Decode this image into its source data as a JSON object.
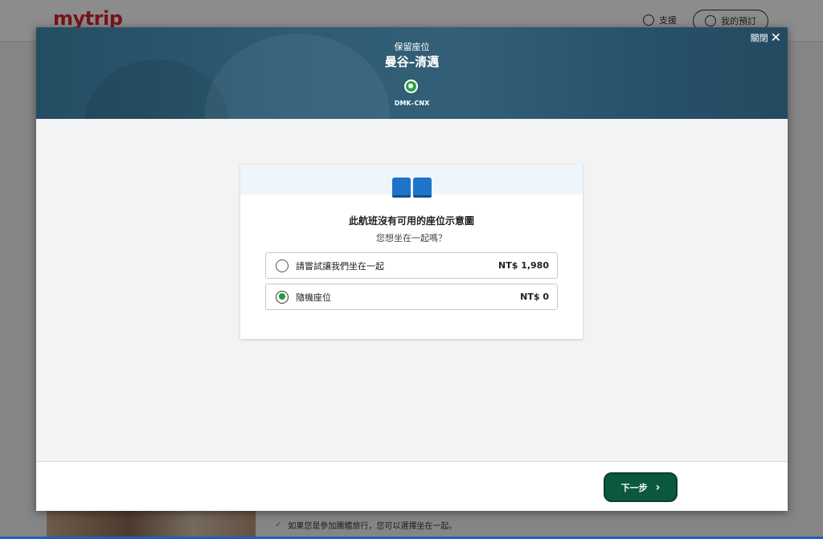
{
  "background": {
    "logo": "mytrip",
    "support_label": "支援",
    "booking_label": "我的預訂",
    "note": "如果您是參加團體旅行，您可以選擇坐在一起。"
  },
  "modal": {
    "close_label": "關閉",
    "kicker": "保留座位",
    "title": "曼谷–清邁",
    "step_label": "DMK–CNX",
    "card": {
      "title": "此航班沒有可用的座位示意圖",
      "subtitle": "您想坐在一起嗎？",
      "options": [
        {
          "label": "請嘗試讓我們坐在一起",
          "price": "NT$ 1,980",
          "selected": false
        },
        {
          "label": "隨機座位",
          "price": "NT$ 0",
          "selected": true
        }
      ]
    },
    "next_label": "下一步"
  },
  "colors": {
    "header": "#2e5c74",
    "accent_green": "#1f9a3a",
    "next_button": "#0b5840",
    "seat_icon": "#1f73c9",
    "logo_red": "#d9262e"
  }
}
